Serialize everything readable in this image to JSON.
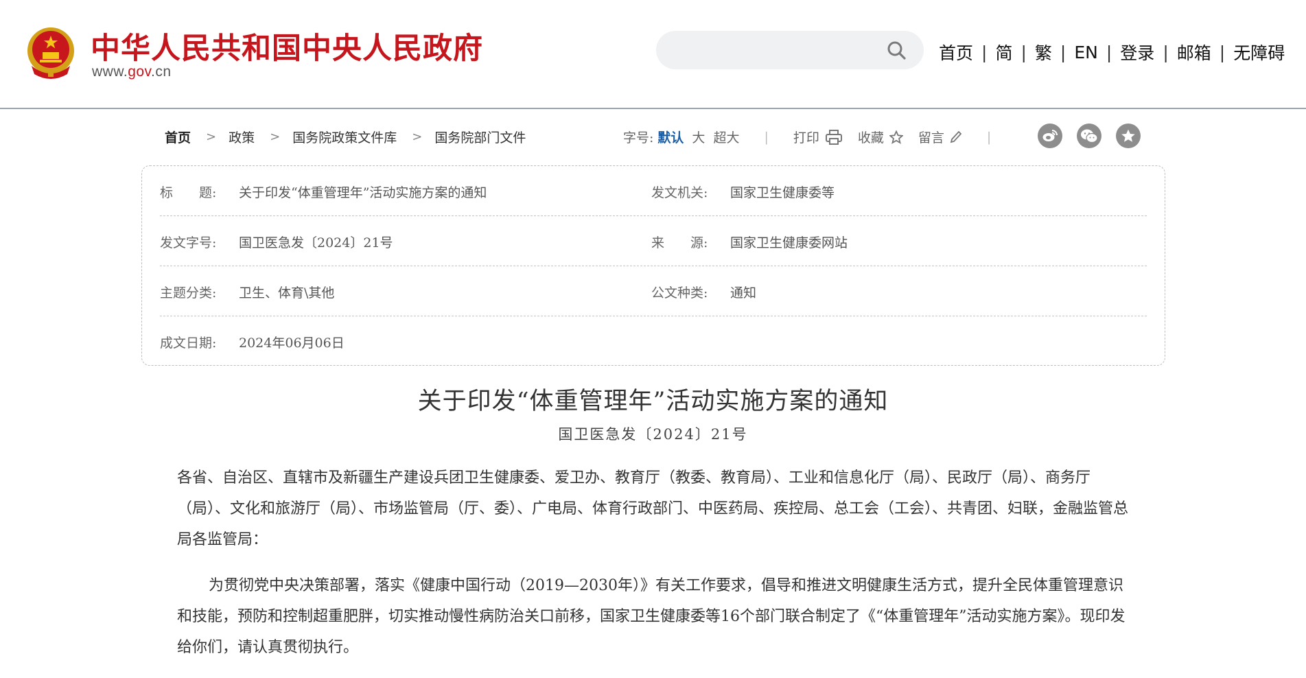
{
  "header": {
    "title": "中华人民共和国中央人民政府",
    "domain_prefix": "www.",
    "domain_mid": "gov",
    "domain_suffix": ".cn",
    "search": {
      "placeholder": ""
    },
    "nav": [
      "首页",
      "简",
      "繁",
      "EN",
      "登录",
      "邮箱",
      "无障碍"
    ],
    "nav_separator": "|"
  },
  "breadcrumb": [
    "首页",
    "政策",
    "国务院政策文件库",
    "国务院部门文件"
  ],
  "breadcrumb_separator": ">",
  "tools": {
    "font_size_label": "字号:",
    "sizes": [
      "默认",
      "大",
      "超大"
    ],
    "print_label": "打印",
    "favorite_label": "收藏",
    "comment_label": "留言",
    "separator": "|"
  },
  "share_icons": [
    "weibo-icon",
    "wechat-icon",
    "star-share-icon"
  ],
  "meta": {
    "title_label": "标　　题:",
    "title_value": "关于印发“体重管理年”活动实施方案的通知",
    "issuer_label": "发文机关:",
    "issuer_value": "国家卫生健康委等",
    "doc_no_label": "发文字号:",
    "doc_no_value": "国卫医急发〔2024〕21号",
    "source_label": "来　　源:",
    "source_value": "国家卫生健康委网站",
    "subject_label": "主题分类:",
    "subject_value": "卫生、体育\\其他",
    "doc_type_label": "公文种类:",
    "doc_type_value": "通知",
    "date_label": "成文日期:",
    "date_value": "2024年06月06日"
  },
  "document": {
    "title": "关于印发“体重管理年”活动实施方案的通知",
    "number": "国卫医急发〔2024〕21号",
    "addressee": "各省、自治区、直辖市及新疆生产建设兵团卫生健康委、爱卫办、教育厅（教委、教育局）、工业和信息化厅（局）、民政厅（局）、商务厅（局）、文化和旅游厅（局）、市场监管局（厅、委）、广电局、体育行政部门、中医药局、疾控局、总工会（工会）、共青团、妇联，金融监管总局各监管局：",
    "paragraph1": "为贯彻党中央决策部署，落实《健康中国行动（2019—2030年）》有关工作要求，倡导和推进文明健康生活方式，提升全民体重管理意识和技能，预防和控制超重肥胖，切实推动慢性病防治关口前移，国家卫生健康委等16个部门联合制定了《“体重管理年”活动实施方案》。现印发给你们，请认真贯彻执行。"
  },
  "colors": {
    "brand_red": "#c4161c",
    "link_blue": "#1a5ea8",
    "icon_gray": "#8d8d8d"
  }
}
